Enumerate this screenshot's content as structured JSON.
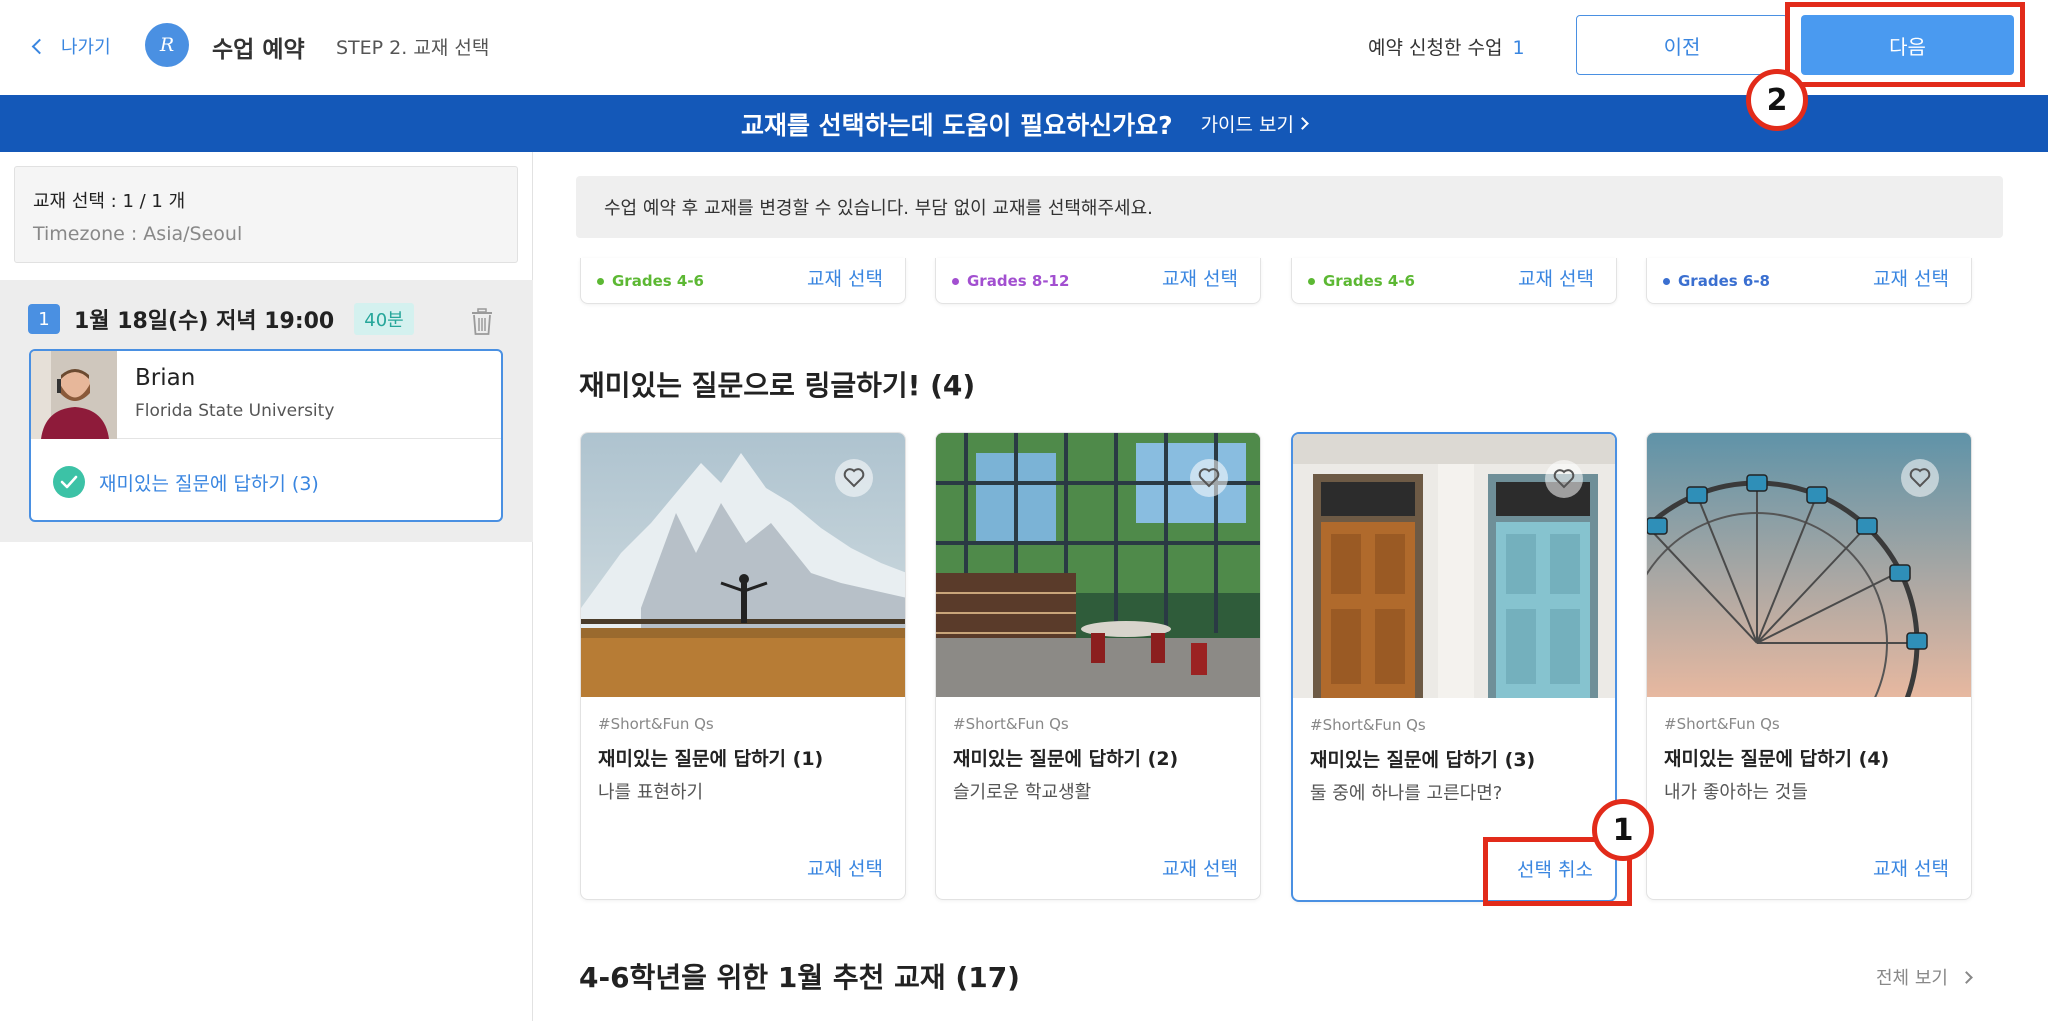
{
  "header": {
    "back_label": "나가기",
    "logo_text": "Ringle",
    "app_title": "수업 예약",
    "step_label": "STEP 2. 교재 선택",
    "reserved_label": "예약 신청한 수업",
    "reserved_count": "1",
    "prev_label": "이전",
    "next_label": "다음"
  },
  "banner": {
    "question": "교재를 선택하는데 도움이 필요하신가요?",
    "guide_label": "가이드 보기"
  },
  "sidebar": {
    "selection": "교재 선택 : 1 / 1 개",
    "timezone": "Timezone : Asia/Seoul",
    "lesson": {
      "number": "1",
      "date": "1월 18일(수) 저녁 19:00",
      "duration": "40분",
      "tutor_name": "Brian",
      "tutor_university": "Florida State University",
      "material": "재미있는 질문에 답하기 (3)"
    }
  },
  "main": {
    "notice": "수업 예약 후 교재를 변경할 수 있습니다. 부담 없이 교재를 선택해주세요.",
    "top_cards": [
      {
        "grade": "Grades 4-6",
        "grade_color": "#5cb833",
        "choose": "교재 선택"
      },
      {
        "grade": "Grades 8-12",
        "grade_color": "#a24fd0",
        "choose": "교재 선택"
      },
      {
        "grade": "Grades 4-6",
        "grade_color": "#5cb833",
        "choose": "교재 선택"
      },
      {
        "grade": "Grades 6-8",
        "grade_color": "#3a6fd0",
        "choose": "교재 선택"
      }
    ],
    "section1_title": "재미있는 질문으로 링글하기! (4)",
    "cards": [
      {
        "tag": "#Short&Fun Qs",
        "title": "재미있는 질문에 답하기 (1)",
        "subtitle": "나를 표현하기",
        "action": "교재 선택"
      },
      {
        "tag": "#Short&Fun Qs",
        "title": "재미있는 질문에 답하기 (2)",
        "subtitle": "슬기로운 학교생활",
        "action": "교재 선택"
      },
      {
        "tag": "#Short&Fun Qs",
        "title": "재미있는 질문에 답하기 (3)",
        "subtitle": "둘 중에 하나를 고른다면?",
        "action": "선택 취소"
      },
      {
        "tag": "#Short&Fun Qs",
        "title": "재미있는 질문에 답하기 (4)",
        "subtitle": "내가 좋아하는 것들",
        "action": "교재 선택"
      }
    ],
    "section2_title": "4-6학년을 위한 1월 추천 교재 (17)",
    "view_all": "전체 보기"
  },
  "annotations": {
    "badge1": "1",
    "badge2": "2",
    "color": "#e22b1a"
  }
}
